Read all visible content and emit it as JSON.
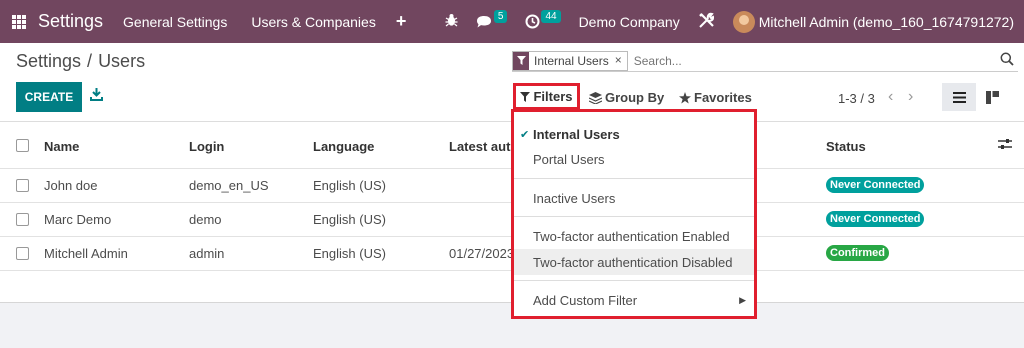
{
  "navbar": {
    "app_title": "Settings",
    "menus": [
      "General Settings",
      "Users & Companies"
    ],
    "plus": "+",
    "messages_count": "5",
    "activities_count": "44",
    "company": "Demo Company",
    "user": "Mitchell Admin (demo_160_1674791272)",
    "bg_color": "#71465f"
  },
  "breadcrumb": {
    "parent": "Settings",
    "separator": "/",
    "current": "Users"
  },
  "search": {
    "facet_label": "Internal Users",
    "facet_remove": "×",
    "placeholder": "Search..."
  },
  "toolbar": {
    "create_label": "CREATE"
  },
  "search_panel": {
    "filters_label": "Filters",
    "groupby_label": "Group By",
    "favorites_label": "Favorites"
  },
  "pager": {
    "value": "1-3 / 3"
  },
  "table": {
    "columns": [
      "Name",
      "Login",
      "Language",
      "Latest authentication",
      "Status"
    ],
    "rows": [
      {
        "name": "John doe",
        "login": "demo_en_US",
        "language": "English (US)",
        "latest": "",
        "status": "Never Connected",
        "status_color": "#00a09d"
      },
      {
        "name": "Marc Demo",
        "login": "demo",
        "language": "English (US)",
        "latest": "",
        "status": "Never Connected",
        "status_color": "#00a09d"
      },
      {
        "name": "Mitchell Admin",
        "login": "admin",
        "language": "English (US)",
        "latest": "01/27/2023",
        "status": "Confirmed",
        "status_color": "#28a745"
      }
    ]
  },
  "filter_dropdown": {
    "items": [
      {
        "label": "Internal Users",
        "checked": true
      },
      {
        "label": "Portal Users"
      },
      {
        "label": "Inactive Users"
      },
      {
        "label": "Two-factor authentication Enabled"
      },
      {
        "label": "Two-factor authentication Disabled",
        "hovered": true
      },
      {
        "label": "Add Custom Filter"
      }
    ],
    "check_mark": "✔",
    "submenu_arrow": "▶"
  },
  "accent_color": "#017e84"
}
